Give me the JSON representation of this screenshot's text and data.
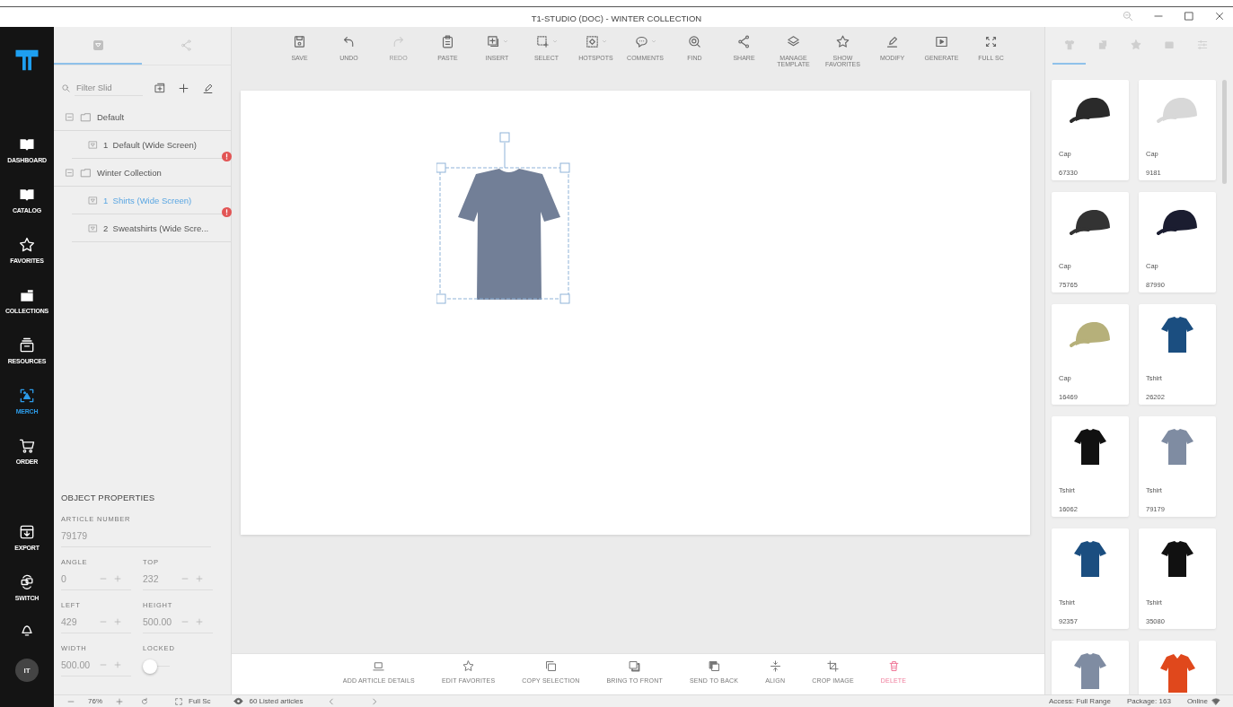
{
  "window": {
    "title": "T1-STUDIO (DOC) - WINTER COLLECTION"
  },
  "nav": {
    "items": [
      {
        "label": "DASHBOARD",
        "selected": false
      },
      {
        "label": "CATALOG",
        "selected": false
      },
      {
        "label": "FAVORITES",
        "selected": false
      },
      {
        "label": "COLLECTIONS",
        "selected": false
      },
      {
        "label": "RESOURCES",
        "selected": false
      },
      {
        "label": "MERCH",
        "selected": true
      },
      {
        "label": "ORDER",
        "selected": false
      }
    ],
    "bottom_items": [
      {
        "label": "EXPORT",
        "selected": false
      },
      {
        "label": "SWITCH",
        "selected": false
      }
    ],
    "avatar": {
      "initials": "IT"
    }
  },
  "slides_panel": {
    "tabs": [
      {
        "selected": true
      },
      {
        "selected": false
      }
    ],
    "filter": {
      "placeholder": "Filter Slid"
    },
    "tree": [
      {
        "label": "Default",
        "expanded": true,
        "alert": false,
        "children": [
          {
            "number": "1",
            "label": "Default (Wide Screen)",
            "selected": false,
            "alert": false
          }
        ]
      },
      {
        "label": "Winter Collection",
        "expanded": true,
        "alert": true,
        "children": [
          {
            "number": "1",
            "label": "Shirts (Wide Screen)",
            "selected": true,
            "alert": false
          },
          {
            "number": "2",
            "label": "Sweatshirts (Wide Scre...",
            "selected": false,
            "alert": true
          }
        ]
      }
    ]
  },
  "object_properties": {
    "title": "OBJECT PROPERTIES",
    "article_number": {
      "label": "ARTICLE NUMBER",
      "value": "79179"
    },
    "fields": [
      {
        "label": "ANGLE",
        "value": "0"
      },
      {
        "label": "TOP",
        "value": "232"
      },
      {
        "label": "LEFT",
        "value": "429"
      },
      {
        "label": "HEIGHT",
        "value": "500.00"
      },
      {
        "label": "WIDTH",
        "value": "500.00"
      }
    ],
    "locked": {
      "label": "LOCKED",
      "on": false
    }
  },
  "toolbar": [
    {
      "label": "SAVE",
      "dropdown": false,
      "disabled": false
    },
    {
      "label": "UNDO",
      "dropdown": false,
      "disabled": false
    },
    {
      "label": "REDO",
      "dropdown": false,
      "disabled": true
    },
    {
      "label": "PASTE",
      "dropdown": false,
      "disabled": false
    },
    {
      "label": "INSERT",
      "dropdown": true,
      "disabled": false
    },
    {
      "label": "SELECT",
      "dropdown": true,
      "disabled": false
    },
    {
      "label": "HOTSPOTS",
      "dropdown": true,
      "disabled": false
    },
    {
      "label": "COMMENTS",
      "dropdown": true,
      "disabled": false
    },
    {
      "label": "FIND",
      "dropdown": false,
      "disabled": false
    },
    {
      "label": "SHARE",
      "dropdown": false,
      "disabled": false
    },
    {
      "label": "MANAGE TEMPLATE",
      "dropdown": false,
      "disabled": false
    },
    {
      "label": "SHOW FAVORITES",
      "dropdown": false,
      "disabled": false
    },
    {
      "label": "MODIFY",
      "dropdown": false,
      "disabled": false
    },
    {
      "label": "GENERATE",
      "dropdown": false,
      "disabled": false
    },
    {
      "label": "FULL SC",
      "dropdown": false,
      "disabled": false
    }
  ],
  "actions": [
    {
      "label": "ADD ARTICLE DETAILS",
      "kind": "normal"
    },
    {
      "label": "EDIT FAVORITES",
      "kind": "normal"
    },
    {
      "label": "COPY SELECTION",
      "kind": "normal"
    },
    {
      "label": "BRING TO FRONT",
      "kind": "normal"
    },
    {
      "label": "SEND TO BACK",
      "kind": "normal"
    },
    {
      "label": "ALIGN",
      "kind": "normal"
    },
    {
      "label": "CROP IMAGE",
      "kind": "normal"
    },
    {
      "label": "DELETE",
      "kind": "danger"
    }
  ],
  "articles_panel": {
    "tabs": [
      {
        "selected": true
      },
      {
        "selected": false
      },
      {
        "selected": false
      },
      {
        "selected": false
      },
      {
        "selected": false
      }
    ],
    "articles": [
      {
        "kind": "cap",
        "name": "Cap",
        "number": "67330",
        "color": "#2a2a2a"
      },
      {
        "kind": "cap",
        "name": "Cap",
        "number": "9181",
        "color": "#d8d8d8"
      },
      {
        "kind": "cap",
        "name": "Cap",
        "number": "75765",
        "color": "#333333"
      },
      {
        "kind": "cap",
        "name": "Cap",
        "number": "87990",
        "color": "#1b1d30"
      },
      {
        "kind": "cap",
        "name": "Cap",
        "number": "16469",
        "color": "#b6b07a"
      },
      {
        "kind": "tshirt",
        "name": "Tshirt",
        "number": "26202",
        "color": "#1b4e80"
      },
      {
        "kind": "tshirt",
        "name": "Tshirt",
        "number": "16062",
        "color": "#111111"
      },
      {
        "kind": "tshirt",
        "name": "Tshirt",
        "number": "79179",
        "color": "#7f8ca2"
      },
      {
        "kind": "tshirt",
        "name": "Tshirt",
        "number": "92357",
        "color": "#1b4e80"
      },
      {
        "kind": "tshirt",
        "name": "Tshirt",
        "number": "35080",
        "color": "#111111"
      },
      {
        "kind": "tshirt",
        "color": "#7f8ca2"
      },
      {
        "kind": "polo",
        "color": "#e0481c"
      }
    ]
  },
  "status_bar": {
    "zoom": "76%",
    "fullscreen": "Full Sc",
    "articles": "60 Listed articles",
    "access": "Access: Full Range",
    "package": "Package: 163",
    "connection": "Online"
  }
}
